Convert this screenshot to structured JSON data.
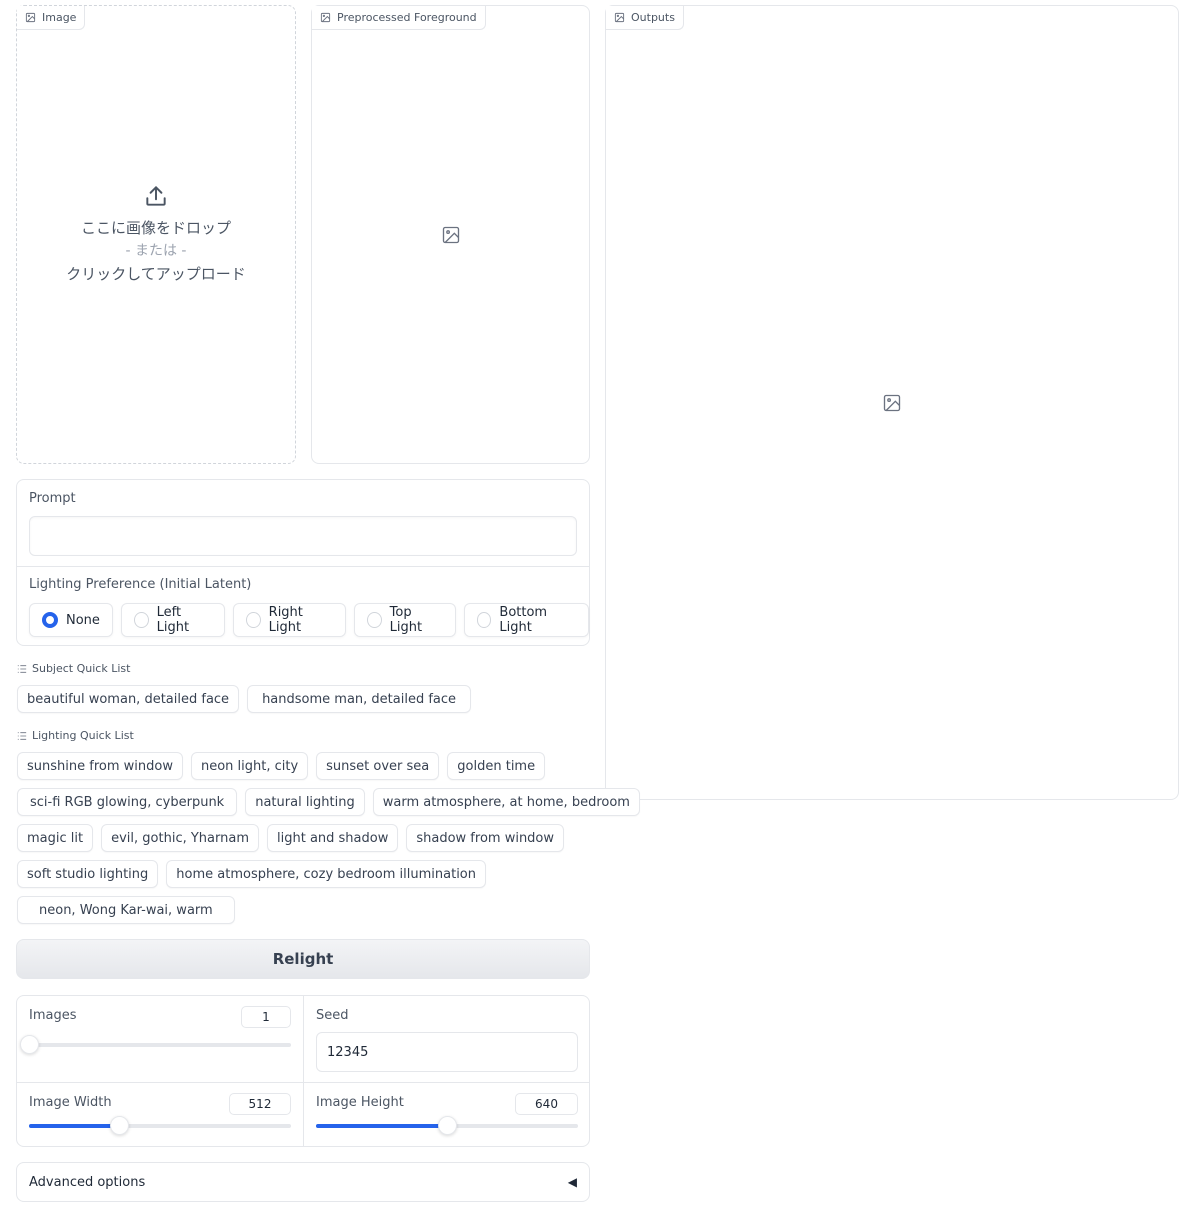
{
  "image_panel": {
    "label": "Image",
    "drop_text": "ここに画像をドロップ",
    "or_text": "- または -",
    "click_text": "クリックしてアップロード"
  },
  "foreground_panel": {
    "label": "Preprocessed Foreground"
  },
  "outputs_panel": {
    "label": "Outputs"
  },
  "prompt": {
    "label": "Prompt",
    "value": ""
  },
  "lighting_preference": {
    "label": "Lighting Preference (Initial Latent)",
    "selected": "None",
    "options": [
      "None",
      "Left Light",
      "Right Light",
      "Top Light",
      "Bottom Light"
    ]
  },
  "subject_quick_list": {
    "label": "Subject Quick List",
    "items": [
      "beautiful woman, detailed face",
      "handsome man, detailed face"
    ]
  },
  "lighting_quick_list": {
    "label": "Lighting Quick List",
    "rows": [
      [
        "sunshine from window",
        "neon light, city",
        "sunset over sea",
        "golden time"
      ],
      [
        "sci-fi RGB glowing, cyberpunk",
        "natural lighting",
        "warm atmosphere, at home, bedroom"
      ],
      [
        "magic lit",
        "evil, gothic, Yharnam",
        "light and shadow",
        "shadow from window"
      ],
      [
        "soft studio lighting",
        "home atmosphere, cozy bedroom illumination"
      ],
      [
        "neon, Wong Kar-wai, warm"
      ]
    ]
  },
  "relight_button": {
    "label": "Relight"
  },
  "settings": {
    "images": {
      "label": "Images",
      "value": "1",
      "fraction": 0.0
    },
    "seed": {
      "label": "Seed",
      "value": "12345"
    },
    "image_width": {
      "label": "Image Width",
      "value": "512",
      "fraction": 0.345
    },
    "image_height": {
      "label": "Image Height",
      "value": "640",
      "fraction": 0.5
    }
  },
  "advanced_options": {
    "label": "Advanced options",
    "arrow": "◀"
  },
  "colors": {
    "accent": "#2563eb",
    "border": "#e5e7eb",
    "button_bg": "#e5e7eb"
  }
}
